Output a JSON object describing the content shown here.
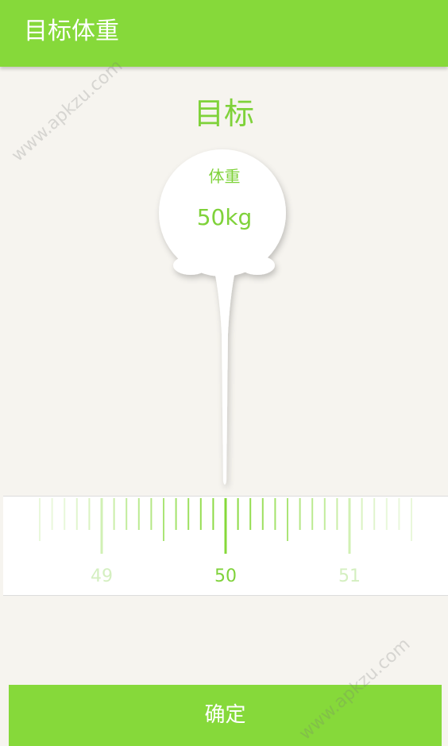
{
  "header": {
    "title": "目标体重"
  },
  "heading": "目标",
  "pin": {
    "label": "体重",
    "value_text": "50kg"
  },
  "ruler": {
    "value": 50,
    "labels": [
      {
        "text": "49",
        "value": 49
      },
      {
        "text": "50",
        "value": 50
      },
      {
        "text": "51",
        "value": 51
      }
    ],
    "min_visible": 48.5,
    "max_visible": 51.5,
    "step": 0.1
  },
  "confirm_label": "确定",
  "watermark": {
    "text": "www.apkzu.com"
  },
  "colors": {
    "accent": "#86d93a",
    "accent_text": "#7fd23a",
    "background": "#f6f4ef",
    "ruler_bg": "#ffffff",
    "tick_muted": "#d4efc0"
  }
}
